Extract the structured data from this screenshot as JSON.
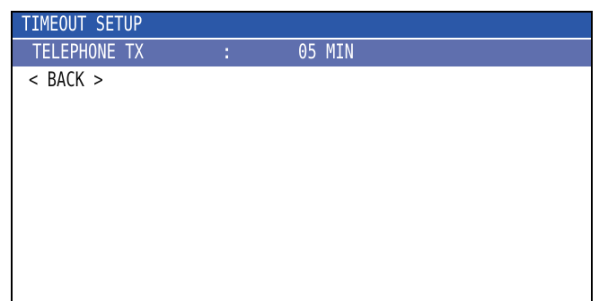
{
  "window": {
    "title": "TIMEOUT SETUP"
  },
  "menu": {
    "items": [
      {
        "label": "TELEPHONE TX",
        "separator": ":",
        "value": "05 MIN",
        "selected": true
      }
    ],
    "back_label": "< BACK >"
  },
  "colors": {
    "title_bar": "#2b58a8",
    "selected_row": "#5f6fae",
    "border": "#000000"
  }
}
